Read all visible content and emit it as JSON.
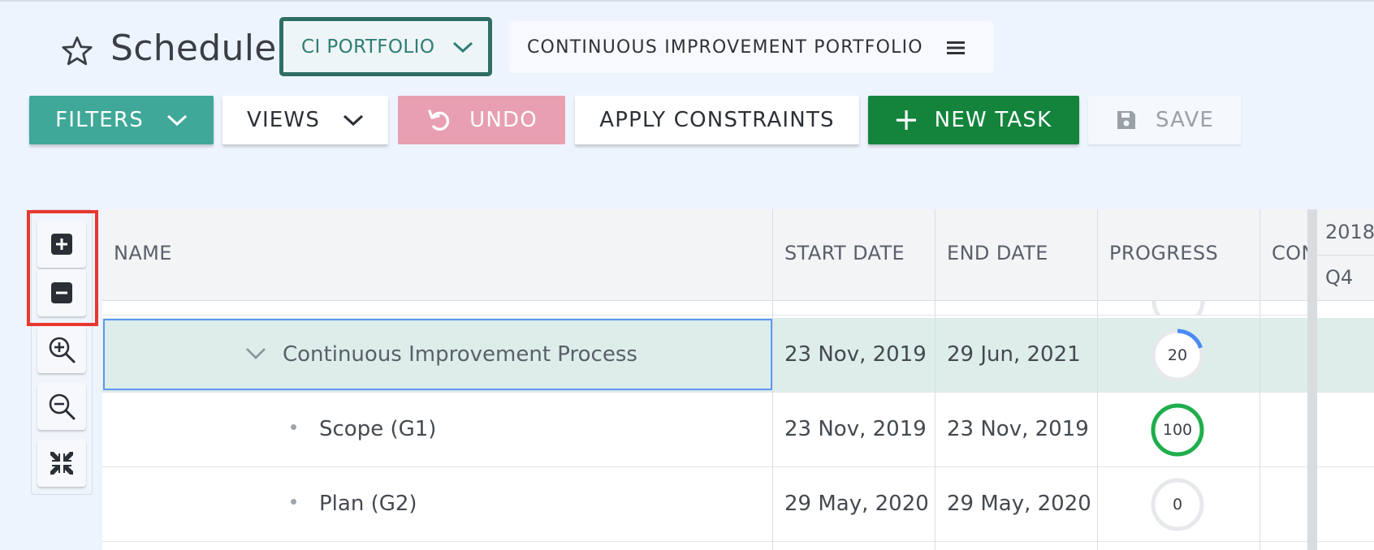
{
  "header": {
    "title": "Schedule",
    "portfolio_select": "CI PORTFOLIO",
    "portfolio_name": "CONTINUOUS IMPROVEMENT PORTFOLIO"
  },
  "toolbar": {
    "filters": "FILTERS",
    "views": "VIEWS",
    "undo": "UNDO",
    "apply_constraints": "APPLY CONSTRAINTS",
    "new_task": "NEW TASK",
    "save": "SAVE"
  },
  "grid": {
    "columns": {
      "name": "NAME",
      "start_date": "START DATE",
      "end_date": "END DATE",
      "progress": "PROGRESS",
      "constraint": "CON"
    },
    "timeline": {
      "year": "2018",
      "quarter": "Q4"
    },
    "rows": [
      {
        "name": "Continuous Improvement Process",
        "start": "23 Nov, 2019",
        "end": "29 Jun, 2021",
        "progress": 20,
        "progress_label": "20",
        "expanded": true,
        "selected": true
      },
      {
        "name": "Scope (G1)",
        "start": "23 Nov, 2019",
        "end": "23 Nov, 2019",
        "progress": 100,
        "progress_label": "100"
      },
      {
        "name": "Plan (G2)",
        "start": "29 May, 2020",
        "end": "29 May, 2020",
        "progress": 0,
        "progress_label": "0"
      }
    ]
  },
  "zoom_controls": [
    "expand-all-icon",
    "collapse-all-icon",
    "zoom-in-icon",
    "zoom-out-icon",
    "zoom-to-fit-icon"
  ],
  "colors": {
    "teal": "#3fa898",
    "green": "#14843d",
    "undo_pink": "#e89fb1",
    "progress_blue": "#4a8af4",
    "progress_green": "#1fae4b",
    "selection": "#dcedea",
    "highlight_red": "#e8382f"
  }
}
